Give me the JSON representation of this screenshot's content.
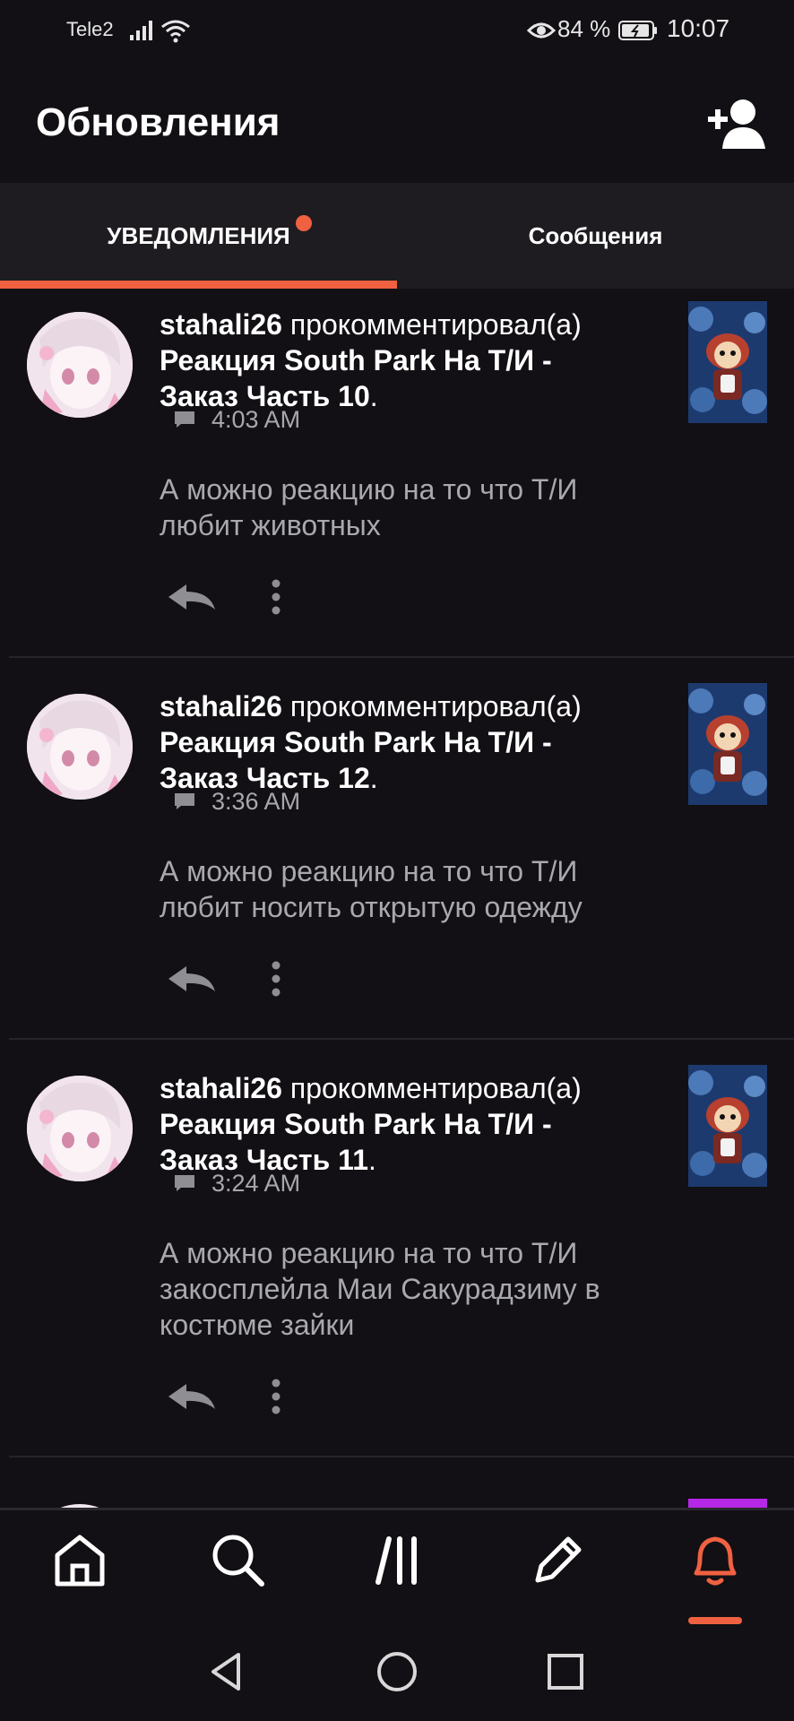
{
  "status_bar": {
    "carrier": "Tele2",
    "battery_percent": "84 %",
    "time": "10:07",
    "icons": [
      "signal-icon",
      "wifi-icon",
      "eye-icon",
      "battery-icon"
    ]
  },
  "header": {
    "title": "Обновления",
    "action_icon": "add-user-icon"
  },
  "tabs": [
    {
      "label": "УВЕДОМЛЕНИЯ",
      "active": true,
      "has_badge": true
    },
    {
      "label": "Сообщения",
      "active": false,
      "has_badge": false
    }
  ],
  "notifications": [
    {
      "user": "stahali26",
      "action": "прокомментировал(а)",
      "story_line1": "Реакция South Park На Т/И -",
      "story_line2": "Заказ Часть 10",
      "time": "4:03 AM",
      "comment_line1": "А можно реакцию на то что Т/И",
      "comment_line2": "любит животных",
      "comment_line3": ""
    },
    {
      "user": "stahali26",
      "action": "прокомментировал(а)",
      "story_line1": "Реакция South Park На Т/И -",
      "story_line2": "Заказ Часть 12",
      "time": "3:36 AM",
      "comment_line1": "А можно реакцию на то что Т/И",
      "comment_line2": "любит носить открытую одежду",
      "comment_line3": ""
    },
    {
      "user": "stahali26",
      "action": "прокомментировал(а)",
      "story_line1": "Реакция South Park На Т/И -",
      "story_line2": "Заказ Часть 11",
      "time": "3:24 AM",
      "comment_line1": "А можно реакцию на то что Т/И",
      "comment_line2": "закосплейла Маи Сакурадзиму в",
      "comment_line3": "костюме зайки"
    }
  ],
  "bottom_nav": [
    {
      "icon": "home-icon",
      "active": false
    },
    {
      "icon": "search-icon",
      "active": false
    },
    {
      "icon": "library-icon",
      "active": false
    },
    {
      "icon": "pencil-icon",
      "active": false
    },
    {
      "icon": "bell-icon",
      "active": true
    }
  ],
  "colors": {
    "accent": "#f06141",
    "background": "#121014",
    "tab_bar": "#1e1c21",
    "secondary_text": "#a9a9ad"
  }
}
